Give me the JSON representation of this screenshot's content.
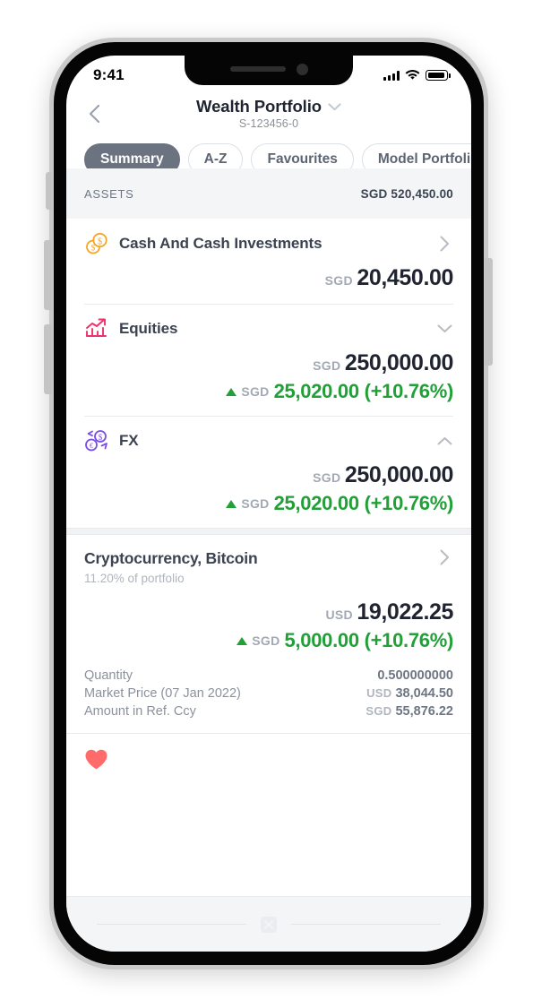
{
  "status_bar": {
    "time": "9:41",
    "signal_icon": "cellular-bars-icon",
    "wifi_icon": "wifi-icon",
    "battery_icon": "battery-full-icon"
  },
  "header": {
    "back_icon": "chevron-left-icon",
    "title": "Wealth Portfolio",
    "title_chevron_icon": "chevron-down-icon",
    "subtitle": "S-123456-0"
  },
  "tabs": [
    {
      "label": "Summary",
      "active": true
    },
    {
      "label": "A-Z",
      "active": false
    },
    {
      "label": "Favourites",
      "active": false
    },
    {
      "label": "Model Portfolio",
      "active": false
    }
  ],
  "assets_band": {
    "label": "ASSETS",
    "total": "SGD 520,450.00"
  },
  "assets": [
    {
      "name": "Cash And Cash Investments",
      "icon": "coins-dollar-icon",
      "chevron": "chevron-right-icon",
      "currency": "SGD",
      "amount": "20,450.00",
      "has_delta": false
    },
    {
      "name": "Equities",
      "icon": "bar-chart-up-icon",
      "chevron": "chevron-down-icon",
      "currency": "SGD",
      "amount": "250,000.00",
      "has_delta": true,
      "delta_direction_icon": "triangle-up-icon",
      "delta_currency": "SGD",
      "delta_value": "25,020.00 (+10.76%)"
    },
    {
      "name": "FX",
      "icon": "currency-exchange-icon",
      "chevron": "chevron-up-icon",
      "currency": "SGD",
      "amount": "250,000.00",
      "has_delta": true,
      "delta_direction_icon": "triangle-up-icon",
      "delta_currency": "SGD",
      "delta_value": "25,020.00 (+10.76%)"
    }
  ],
  "holding": {
    "title": "Cryptocurrency, Bitcoin",
    "chevron": "chevron-right-icon",
    "portfolio_share": "11.20% of portfolio",
    "currency": "USD",
    "amount": "19,022.25",
    "delta_direction_icon": "triangle-up-icon",
    "delta_currency": "SGD",
    "delta_value": "5,000.00 (+10.76%)",
    "details": [
      {
        "key": "Quantity",
        "currency": "",
        "value": "0.500000000"
      },
      {
        "key": "Market Price (07 Jan 2022)",
        "currency": "USD",
        "value": "38,044.50"
      },
      {
        "key": "Amount in Ref. Ccy",
        "currency": "SGD",
        "value": "55,876.22"
      }
    ],
    "favourite_icon": "heart-filled-icon",
    "favourite_active": true
  },
  "bottom_bar": {
    "icon": "image-placeholder-icon"
  },
  "colors": {
    "accent_positive": "#21A038",
    "tab_active_bg": "#6B7280",
    "heart": "#FF6B6B",
    "cash_icon": "#F5A623",
    "equities_icon": "#F0306B",
    "fx_icon": "#7B4DEA",
    "band_bg": "#F4F5F7"
  }
}
